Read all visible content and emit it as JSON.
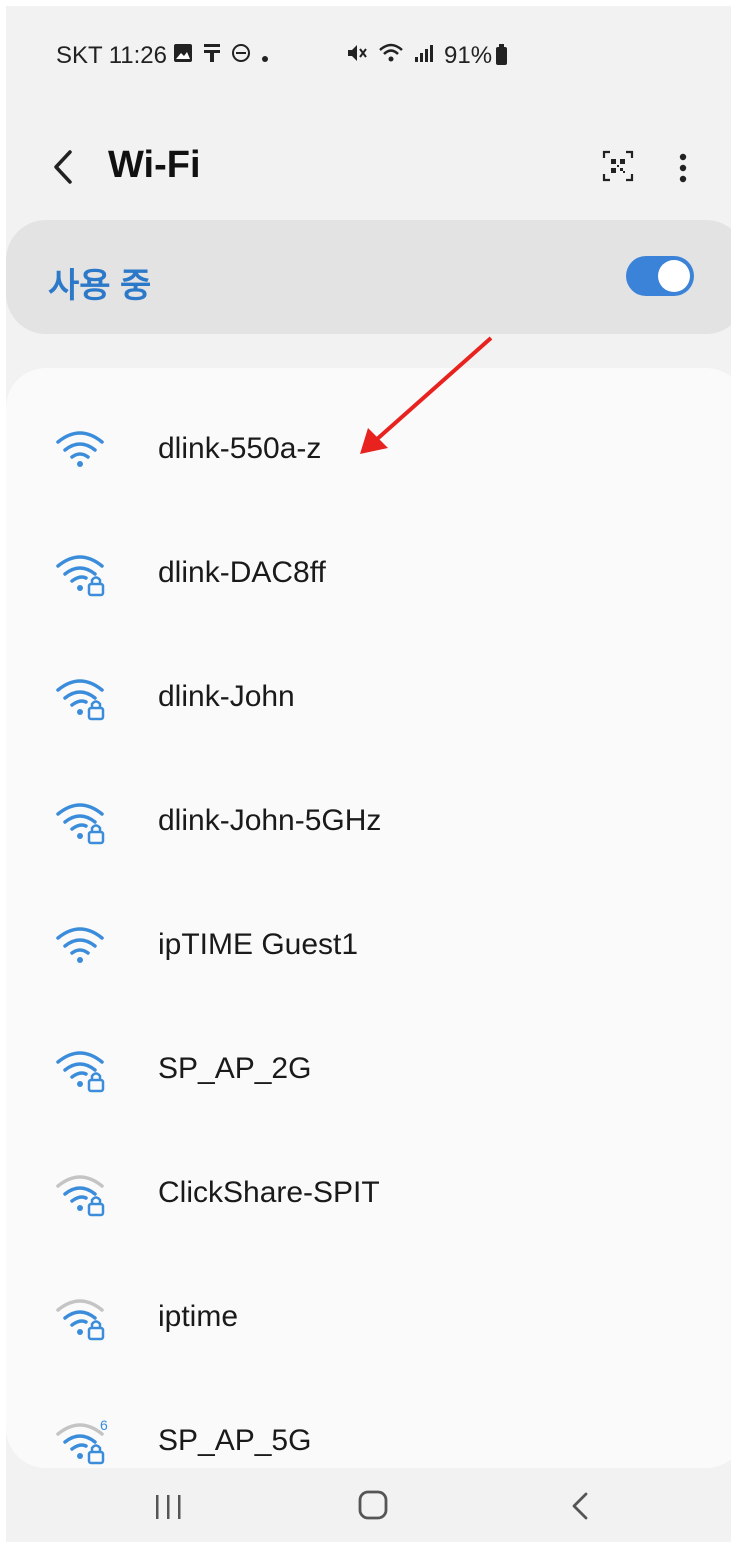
{
  "status_bar": {
    "carrier": "SKT",
    "time": "11:26",
    "battery_percent": "91%"
  },
  "app_bar": {
    "title": "Wi-Fi"
  },
  "master_switch": {
    "label": "사용 중",
    "state": true,
    "accent_color": "#3b83d8"
  },
  "networks": [
    {
      "name": "dlink-550a-z",
      "secured": false,
      "signal": "strong-blue"
    },
    {
      "name": "dlink-DAC8ff",
      "secured": true,
      "signal": "strong-blue"
    },
    {
      "name": "dlink-John",
      "secured": true,
      "signal": "strong-blue"
    },
    {
      "name": "dlink-John-5GHz",
      "secured": true,
      "signal": "strong-blue"
    },
    {
      "name": "ipTIME Guest1",
      "secured": false,
      "signal": "strong-blue"
    },
    {
      "name": "SP_AP_2G",
      "secured": true,
      "signal": "strong-blue"
    },
    {
      "name": "ClickShare-SPIT",
      "secured": true,
      "signal": "weak"
    },
    {
      "name": "iptime",
      "secured": true,
      "signal": "weak"
    },
    {
      "name": "SP_AP_5G",
      "secured": true,
      "signal": "wifi6",
      "badge": "6"
    }
  ],
  "colors": {
    "wifi_blue": "#3b8ddb",
    "wifi_grey": "#c4c4c4",
    "annotation_red": "#e8231f"
  }
}
